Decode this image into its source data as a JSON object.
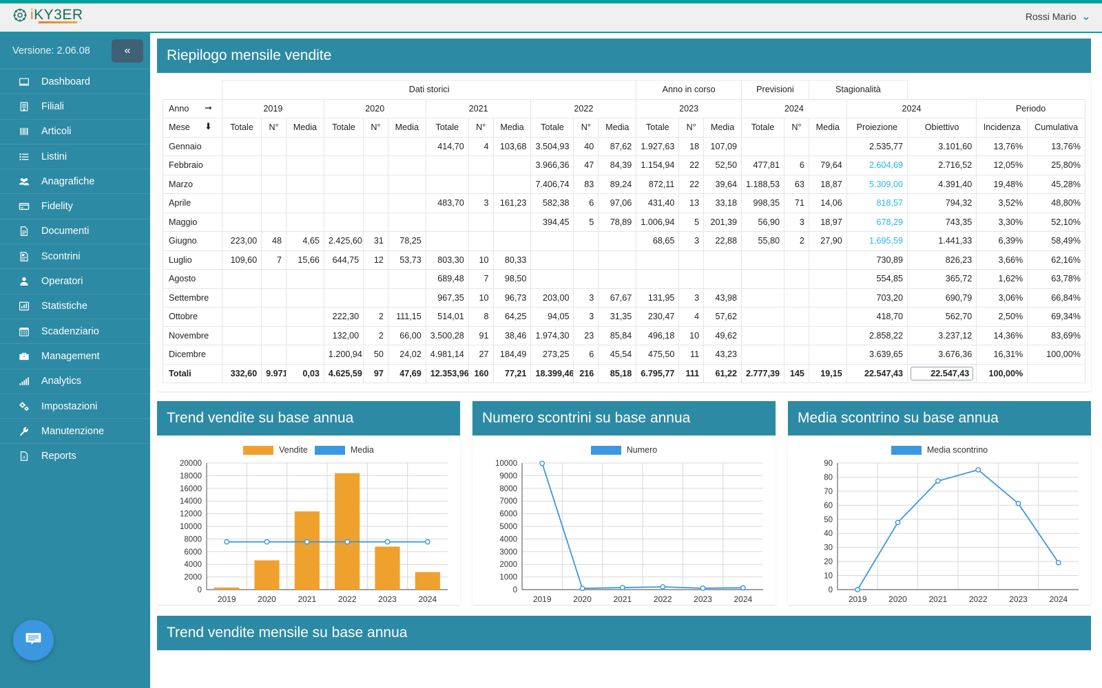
{
  "header": {
    "logo_i": "i",
    "logo_rest": "KY3ER",
    "user_name": "Rossi Mario",
    "user_caret_icon": "chevron-down-icon"
  },
  "sidebar": {
    "version_label": "Versione: 2.06.08",
    "collapse_icon": "double-chevron-left-icon",
    "items": [
      {
        "label": "Dashboard",
        "icon": "monitor-icon"
      },
      {
        "label": "Filiali",
        "icon": "building-icon"
      },
      {
        "label": "Articoli",
        "icon": "barcode-icon"
      },
      {
        "label": "Listini",
        "icon": "list-icon"
      },
      {
        "label": "Anagrafiche",
        "icon": "users-icon"
      },
      {
        "label": "Fidelity",
        "icon": "card-icon"
      },
      {
        "label": "Documenti",
        "icon": "document-icon"
      },
      {
        "label": "Scontrini",
        "icon": "receipt-icon"
      },
      {
        "label": "Operatori",
        "icon": "user-icon"
      },
      {
        "label": "Statistiche",
        "icon": "bar-chart-icon"
      },
      {
        "label": "Scadenziario",
        "icon": "calendar-icon"
      },
      {
        "label": "Management",
        "icon": "briefcase-icon"
      },
      {
        "label": "Analytics",
        "icon": "signal-icon"
      },
      {
        "label": "Impostazioni",
        "icon": "gears-icon"
      },
      {
        "label": "Manutenzione",
        "icon": "wrench-icon"
      },
      {
        "label": "Reports",
        "icon": "pdf-file-icon"
      }
    ],
    "chat_icon": "chat-bubble-icon"
  },
  "page": {
    "title": "Riepilogo mensile vendite"
  },
  "table": {
    "super_groups": [
      {
        "label": "Dati storici",
        "span": 12
      },
      {
        "label": "Anno in corso",
        "span": 3
      },
      {
        "label": "Previsioni",
        "span": 2
      },
      {
        "label": "Stagionalità",
        "span": 2
      }
    ],
    "year_row_label": "Anno",
    "year_row_arrow": "arrow-right-icon",
    "year_groups": [
      {
        "label": "2019",
        "span": 3
      },
      {
        "label": "2020",
        "span": 3
      },
      {
        "label": "2021",
        "span": 3
      },
      {
        "label": "2022",
        "span": 3
      },
      {
        "label": "2023",
        "span": 3
      },
      {
        "label": "2024",
        "span": 3
      },
      {
        "label": "2024",
        "span": 2
      },
      {
        "label": "Periodo",
        "span": 2
      }
    ],
    "month_row_label": "Mese",
    "month_row_arrow": "arrow-down-icon",
    "sub_headers": [
      "Totale",
      "N°",
      "Media",
      "Totale",
      "N°",
      "Media",
      "Totale",
      "N°",
      "Media",
      "Totale",
      "N°",
      "Media",
      "Totale",
      "N°",
      "Media",
      "Totale",
      "N°",
      "Media",
      "Proiezione",
      "Obiettivo",
      "Incidenza",
      "Cumulativa"
    ],
    "rows": [
      {
        "mese": "Gennaio",
        "cells": [
          "",
          "",
          "",
          "",
          "",
          "",
          "414,70",
          "4",
          "103,68",
          "3.504,93",
          "40",
          "87,62",
          "1.927,63",
          "18",
          "107,09",
          "",
          "",
          "",
          "2.535,77",
          "3.101,60",
          "13,76%",
          "13,76%"
        ],
        "proj_highlight": false
      },
      {
        "mese": "Febbraio",
        "cells": [
          "",
          "",
          "",
          "",
          "",
          "",
          "",
          "",
          "",
          "3.966,36",
          "47",
          "84,39",
          "1.154,94",
          "22",
          "52,50",
          "477,81",
          "6",
          "79,64",
          "2.604,69",
          "2.716,52",
          "12,05%",
          "25,80%"
        ],
        "proj_highlight": true
      },
      {
        "mese": "Marzo",
        "cells": [
          "",
          "",
          "",
          "",
          "",
          "",
          "",
          "",
          "",
          "7.406,74",
          "83",
          "89,24",
          "872,11",
          "22",
          "39,64",
          "1.188,53",
          "63",
          "18,87",
          "5.309,00",
          "4.391,40",
          "19,48%",
          "45,28%"
        ],
        "proj_highlight": true
      },
      {
        "mese": "Aprile",
        "cells": [
          "",
          "",
          "",
          "",
          "",
          "",
          "483,70",
          "3",
          "161,23",
          "582,38",
          "6",
          "97,06",
          "431,40",
          "13",
          "33,18",
          "998,35",
          "71",
          "14,06",
          "818,57",
          "794,32",
          "3,52%",
          "48,80%"
        ],
        "proj_highlight": true
      },
      {
        "mese": "Maggio",
        "cells": [
          "",
          "",
          "",
          "",
          "",
          "",
          "",
          "",
          "",
          "394,45",
          "5",
          "78,89",
          "1.006,94",
          "5",
          "201,39",
          "56,90",
          "3",
          "18,97",
          "678,29",
          "743,35",
          "3,30%",
          "52,10%"
        ],
        "proj_highlight": true
      },
      {
        "mese": "Giugno",
        "cells": [
          "223,00",
          "48",
          "4,65",
          "2.425,60",
          "31",
          "78,25",
          "",
          "",
          "",
          "",
          "",
          "",
          "68,65",
          "3",
          "22,88",
          "55,80",
          "2",
          "27,90",
          "1.695,59",
          "1.441,33",
          "6,39%",
          "58,49%"
        ],
        "proj_highlight": true
      },
      {
        "mese": "Luglio",
        "cells": [
          "109,60",
          "7",
          "15,66",
          "644,75",
          "12",
          "53,73",
          "803,30",
          "10",
          "80,33",
          "",
          "",
          "",
          "",
          "",
          "",
          "",
          "",
          "",
          "730,89",
          "826,23",
          "3,66%",
          "62,16%"
        ],
        "proj_highlight": false
      },
      {
        "mese": "Agosto",
        "cells": [
          "",
          "",
          "",
          "",
          "",
          "",
          "689,48",
          "7",
          "98,50",
          "",
          "",
          "",
          "",
          "",
          "",
          "",
          "",
          "",
          "554,85",
          "365,72",
          "1,62%",
          "63,78%"
        ],
        "proj_highlight": false
      },
      {
        "mese": "Settembre",
        "cells": [
          "",
          "",
          "",
          "",
          "",
          "",
          "967,35",
          "10",
          "96,73",
          "203,00",
          "3",
          "67,67",
          "131,95",
          "3",
          "43,98",
          "",
          "",
          "",
          "703,20",
          "690,79",
          "3,06%",
          "66,84%"
        ],
        "proj_highlight": false
      },
      {
        "mese": "Ottobre",
        "cells": [
          "",
          "",
          "",
          "222,30",
          "2",
          "111,15",
          "514,01",
          "8",
          "64,25",
          "94,05",
          "3",
          "31,35",
          "230,47",
          "4",
          "57,62",
          "",
          "",
          "",
          "418,70",
          "562,70",
          "2,50%",
          "69,34%"
        ],
        "proj_highlight": false
      },
      {
        "mese": "Novembre",
        "cells": [
          "",
          "",
          "",
          "132,00",
          "2",
          "66,00",
          "3.500,28",
          "91",
          "38,46",
          "1.974,30",
          "23",
          "85,84",
          "496,18",
          "10",
          "49,62",
          "",
          "",
          "",
          "2.858,22",
          "3.237,12",
          "14,36%",
          "83,69%"
        ],
        "proj_highlight": false
      },
      {
        "mese": "Dicembre",
        "cells": [
          "",
          "",
          "",
          "1.200,94",
          "50",
          "24,02",
          "4.981,14",
          "27",
          "184,49",
          "273,25",
          "6",
          "45,54",
          "475,50",
          "11",
          "43,23",
          "",
          "",
          "",
          "3.639,65",
          "3.676,36",
          "16,31%",
          "100,00%"
        ],
        "proj_highlight": false
      }
    ],
    "totals": {
      "label": "Totali",
      "cells": [
        "332,60",
        "9.971",
        "0,03",
        "4.625,59",
        "97",
        "47,69",
        "12.353,96",
        "160",
        "77,21",
        "18.399,46",
        "216",
        "85,18",
        "6.795,77",
        "111",
        "61,22",
        "2.777,39",
        "145",
        "19,15",
        "22.547,43"
      ],
      "obiettivo_input": "22.547,43",
      "incidenza": "100,00%",
      "cumulativa": ""
    }
  },
  "charts": [
    {
      "title": "Trend vendite su base annua",
      "chart_data": {
        "type": "bar",
        "title": "Trend vendite su base annua",
        "categories": [
          "2019",
          "2020",
          "2021",
          "2022",
          "2023",
          "2024"
        ],
        "series": [
          {
            "name": "Vendite",
            "type": "bar",
            "color": "#efa12e",
            "values": [
              332.6,
              4625.59,
              12353.96,
              18399.46,
              6795.77,
              2777.39
            ]
          },
          {
            "name": "Media",
            "type": "line",
            "color": "#3b97e0",
            "values": [
              7547.46,
              7547.46,
              7547.46,
              7547.46,
              7547.46,
              7547.46
            ]
          }
        ],
        "ylim": [
          0,
          20000
        ],
        "yticks": [
          0,
          2000,
          4000,
          6000,
          8000,
          10000,
          12000,
          14000,
          16000,
          18000,
          20000
        ],
        "xlabel": "",
        "ylabel": "",
        "grid": true,
        "legend": "top"
      }
    },
    {
      "title": "Numero scontrini su base annua",
      "chart_data": {
        "type": "line",
        "title": "Numero scontrini su base annua",
        "categories": [
          "2019",
          "2020",
          "2021",
          "2022",
          "2023",
          "2024"
        ],
        "series": [
          {
            "name": "Numero",
            "type": "line",
            "color": "#3b97e0",
            "values": [
              9971,
              97,
              160,
              216,
              111,
              145
            ]
          }
        ],
        "ylim": [
          0,
          10000
        ],
        "yticks": [
          0,
          1000,
          2000,
          3000,
          4000,
          5000,
          6000,
          7000,
          8000,
          9000,
          10000
        ],
        "xlabel": "",
        "ylabel": "",
        "grid": true,
        "legend": "top"
      }
    },
    {
      "title": "Media scontrino su base annua",
      "chart_data": {
        "type": "line",
        "title": "Media scontrino su base annua",
        "categories": [
          "2019",
          "2020",
          "2021",
          "2022",
          "2023",
          "2024"
        ],
        "series": [
          {
            "name": "Media scontrino",
            "type": "line",
            "color": "#3b97e0",
            "values": [
              0.03,
              47.69,
              77.21,
              85.18,
              61.22,
              19.15
            ]
          }
        ],
        "ylim": [
          0,
          90
        ],
        "yticks": [
          0,
          10,
          20,
          30,
          40,
          50,
          60,
          70,
          80,
          90
        ],
        "xlabel": "",
        "ylabel": "",
        "grid": true,
        "legend": "top"
      }
    }
  ],
  "bottom_panel": {
    "title": "Trend vendite mensile su base annua"
  },
  "colors": {
    "accent_teal": "#00a29a",
    "panel_teal": "#2d8aa4",
    "sidebar_teal": "#2d8aa4",
    "bar_orange": "#efa12e",
    "line_blue": "#3b97e0",
    "projection_blue": "#29b6e8"
  }
}
